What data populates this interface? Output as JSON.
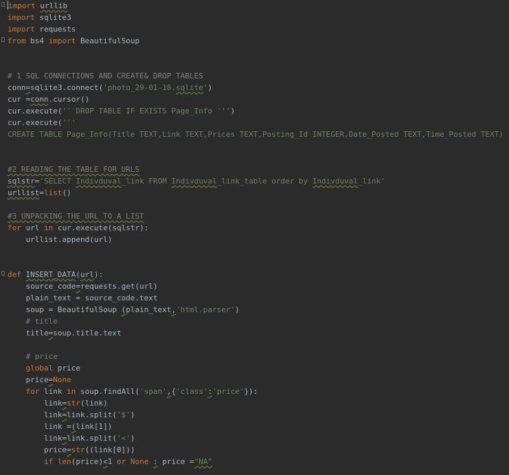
{
  "editor": {
    "colors": {
      "background": "#2b2b2b",
      "default": "#a9b7c6",
      "keyword": "#cc7832",
      "string": "#6a8759",
      "comment": "#808080"
    },
    "lines": [
      [
        {
          "t": "import",
          "c": "kw"
        },
        {
          "t": " "
        },
        {
          "t": "urllib",
          "s": 1
        }
      ],
      [
        {
          "t": "import",
          "c": "kw"
        },
        {
          "t": " sqlite3"
        }
      ],
      [
        {
          "t": "import",
          "c": "kw"
        },
        {
          "t": " requests"
        }
      ],
      [
        {
          "t": "from",
          "c": "kw"
        },
        {
          "t": " bs4 "
        },
        {
          "t": "import",
          "c": "kw"
        },
        {
          "t": " BeautifulSoup"
        }
      ],
      [],
      [],
      [
        {
          "t": "# 1 SQL CONNECTIONS AND CREATE& DROP TABLES",
          "c": "cm"
        }
      ],
      [
        {
          "t": "conn"
        },
        {
          "t": "=",
          "s": 1
        },
        {
          "t": "sqlite3.connect("
        },
        {
          "t": "'photo_29-01-16.",
          "c": "str"
        },
        {
          "t": "sqlite",
          "c": "str",
          "s": 1
        },
        {
          "t": "'",
          "c": "str"
        },
        {
          "t": ")"
        }
      ],
      [
        {
          "t": "cur ="
        },
        {
          "t": "conn",
          "s": 1
        },
        {
          "t": ".cursor()"
        }
      ],
      [
        {
          "t": "cur.execute("
        },
        {
          "t": "'''DROP TABLE IF EXISTS Page_Info '''",
          "c": "str"
        },
        {
          "t": ")"
        }
      ],
      [
        {
          "t": "cur.execute("
        },
        {
          "t": "'''",
          "c": "str"
        }
      ],
      [
        {
          "t": "CREATE TABLE Page_Info(Title TEXT,Link TEXT,Prices TEXT,Posting_Id INTEGER,Date_Posted TEXT,Time_Posted TEXT)",
          "c": "str"
        }
      ],
      [],
      [],
      [
        {
          "t": "#2 READING THE TABLE FOR URLS",
          "c": "cm",
          "s": 1
        }
      ],
      [
        {
          "t": "sqlstr",
          "s": 1
        },
        {
          "t": "="
        },
        {
          "t": "'SELECT ",
          "c": "str"
        },
        {
          "t": "Indivduval",
          "c": "str",
          "s": 1
        },
        {
          "t": "_link FROM ",
          "c": "str"
        },
        {
          "t": "Indivduval",
          "c": "str",
          "s": 1
        },
        {
          "t": "_link_table order by ",
          "c": "str"
        },
        {
          "t": "Indivduval",
          "c": "str",
          "s": 1
        },
        {
          "t": "_link'",
          "c": "str"
        }
      ],
      [
        {
          "t": "urllist",
          "s": 1
        },
        {
          "t": "="
        },
        {
          "t": "list",
          "c": "kw"
        },
        {
          "t": "()"
        }
      ],
      [],
      [
        {
          "t": "#3 UNPACKING THE URL TO A LIST",
          "c": "cm",
          "s": 1
        }
      ],
      [
        {
          "t": "for",
          "c": "kw"
        },
        {
          "t": " url "
        },
        {
          "t": "in",
          "c": "kw"
        },
        {
          "t": " cur.execute(sqlstr):"
        }
      ],
      [
        {
          "t": "    urllist.append(url)"
        }
      ],
      [],
      [],
      [
        {
          "t": "def",
          "c": "kw"
        },
        {
          "t": " "
        },
        {
          "t": "INSERT_DATA",
          "s": 1
        },
        {
          "t": "("
        },
        {
          "t": "url",
          "s": 1
        },
        {
          "t": "):"
        }
      ],
      [
        {
          "t": "    source_code"
        },
        {
          "t": "=",
          "s": 1
        },
        {
          "t": "requests.get(url)"
        }
      ],
      [
        {
          "t": "    plain_text = source_code.text"
        }
      ],
      [
        {
          "t": "    soup = BeautifulSoup "
        },
        {
          "t": "(",
          "s": 1
        },
        {
          "t": "plain_text"
        },
        {
          "t": ",",
          "s": 1
        },
        {
          "t": "'html.parser'",
          "c": "str"
        },
        {
          "t": ")"
        }
      ],
      [
        {
          "t": "    # title",
          "c": "cm"
        }
      ],
      [
        {
          "t": "    title"
        },
        {
          "t": "=",
          "s": 1
        },
        {
          "t": "soup.title.text"
        }
      ],
      [],
      [
        {
          "t": "    # price",
          "c": "cm"
        }
      ],
      [
        {
          "t": "    "
        },
        {
          "t": "global",
          "c": "kw"
        },
        {
          "t": " price"
        }
      ],
      [
        {
          "t": "    price"
        },
        {
          "t": "=",
          "s": 1
        },
        {
          "t": "None",
          "c": "kw"
        }
      ],
      [
        {
          "t": "    "
        },
        {
          "t": "for",
          "c": "kw"
        },
        {
          "t": " link "
        },
        {
          "t": "in",
          "c": "kw"
        },
        {
          "t": " soup.findAll("
        },
        {
          "t": "'span'",
          "c": "str"
        },
        {
          "t": ",",
          "s": 1
        },
        {
          "t": "{"
        },
        {
          "t": "'class'",
          "c": "str"
        },
        {
          "t": ":",
          "s": 1
        },
        {
          "t": "'price'",
          "c": "str"
        },
        {
          "t": "}):"
        }
      ],
      [
        {
          "t": "        link"
        },
        {
          "t": "=",
          "s": 1
        },
        {
          "t": "str",
          "c": "kw"
        },
        {
          "t": "(link)"
        }
      ],
      [
        {
          "t": "        link"
        },
        {
          "t": "=",
          "s": 1
        },
        {
          "t": "link.split("
        },
        {
          "t": "'$'",
          "c": "str"
        },
        {
          "t": ")"
        }
      ],
      [
        {
          "t": "        link ="
        },
        {
          "t": "(",
          "s": 1
        },
        {
          "t": "link[1])"
        }
      ],
      [
        {
          "t": "        link"
        },
        {
          "t": "=",
          "s": 1
        },
        {
          "t": "link.split("
        },
        {
          "t": "'<'",
          "c": "str"
        },
        {
          "t": ")"
        }
      ],
      [
        {
          "t": "        price"
        },
        {
          "t": "=",
          "s": 1
        },
        {
          "t": "str",
          "c": "kw"
        },
        {
          "t": "((link[0]))"
        }
      ],
      [
        {
          "t": "        "
        },
        {
          "t": "if",
          "c": "kw"
        },
        {
          "t": " "
        },
        {
          "t": "len",
          "c": "kw"
        },
        {
          "t": "(price)"
        },
        {
          "t": "<",
          "s": 1
        },
        {
          "t": "1 "
        },
        {
          "t": "or",
          "c": "kw"
        },
        {
          "t": " "
        },
        {
          "t": "None",
          "c": "kw"
        },
        {
          "t": " "
        },
        {
          "t": ":",
          "s": 1
        },
        {
          "t": " price ="
        },
        {
          "t": "\"NA\"",
          "c": "str",
          "s": 1
        }
      ]
    ]
  }
}
